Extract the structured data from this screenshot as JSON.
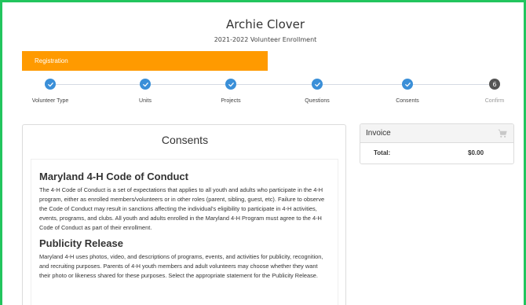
{
  "header": {
    "name": "Archie Clover",
    "subtitle": "2021-2022 Volunteer Enrollment"
  },
  "registration_bar": {
    "label": "Registration"
  },
  "steps": [
    {
      "label": "Volunteer Type",
      "state": "complete",
      "icon": "check-icon"
    },
    {
      "label": "Units",
      "state": "complete",
      "icon": "check-icon"
    },
    {
      "label": "Projects",
      "state": "complete",
      "icon": "check-icon"
    },
    {
      "label": "Questions",
      "state": "complete",
      "icon": "check-icon"
    },
    {
      "label": "Consents",
      "state": "current",
      "icon": "check-icon"
    },
    {
      "label": "Confirm",
      "state": "upcoming",
      "number": "6"
    }
  ],
  "consents": {
    "title": "Consents",
    "sections": [
      {
        "title": "Maryland 4-H Code of Conduct",
        "body": "The 4-H Code of Conduct is a set of expectations that applies to all youth and adults who participate in the 4-H program, either as enrolled members/volunteers or in other roles (parent, sibling, guest, etc).    Failure to observe the Code of Conduct may result in sanctions affecting the individual's eligibility to participate in 4-H activities, events, programs, and clubs.  All youth and adults enrolled in the Maryland 4-H Program must agree to the 4-H Code of Conduct as part of their enrollment."
      },
      {
        "title": "Publicity Release",
        "body": "Maryland 4-H uses photos, video, and descriptions of programs, events, and activities for publicity, recognition, and recruiting purposes.  Parents of 4-H youth members and adult volunteers may choose whether they want their photo or likeness shared for these purposes.  Select the appropriate statement for the Publicity Release."
      }
    ]
  },
  "invoice": {
    "title": "Invoice",
    "icon": "cart-icon",
    "total_label": "Total:",
    "total_value": "$0.00"
  },
  "colors": {
    "frame_border": "#22c55e",
    "registration_bar": "#ff9a00",
    "step_complete": "#3a8fd8",
    "step_upcoming": "#555555"
  }
}
